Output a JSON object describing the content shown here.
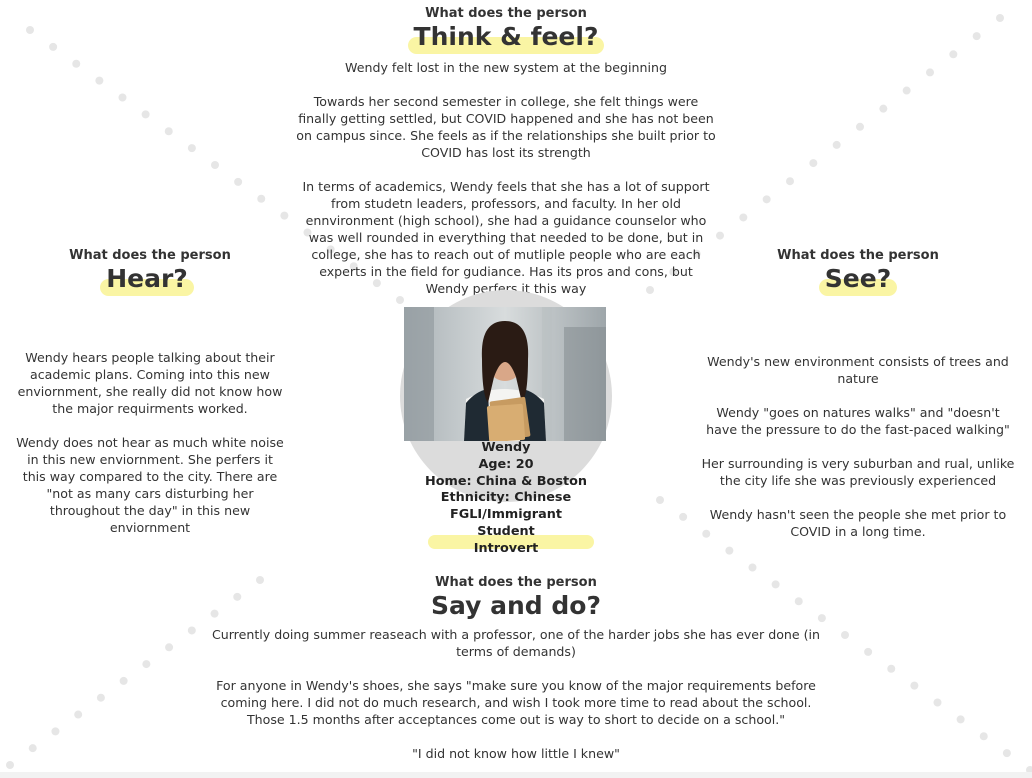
{
  "think": {
    "subtitle": "What does the person",
    "heading": "Think & feel?",
    "paragraphs": [
      "Wendy felt lost in the new system at the beginning",
      "Towards her second semester in college, she felt things were finally getting settled, but COVID happened and she has not been on campus since. She feels as if the relationships she built prior to COVID has lost its strength",
      "In terms of academics, Wendy feels that she has a lot of support from studetn leaders, professors, and faculty. In her old ennvironment (high school), she had a guidance counselor who was well rounded in everything that needed to be done, but in college, she has to reach out of mutliple people who are each experts in the field for gudiance. Has its pros and cons, but Wendy perfers it this way"
    ]
  },
  "hear": {
    "subtitle": "What does the person",
    "heading": "Hear?",
    "paragraphs": [
      "Wendy hears people talking about their academic plans. Coming into this new enviornment, she really did not know how the major requirments worked.",
      "Wendy does not hear as much white noise in this new enviornment. She perfers it this way compared to the city. There are \"not as many cars disturbing her throughout the day\" in this new enviornment"
    ]
  },
  "see": {
    "subtitle": "What does the person",
    "heading": "See?",
    "paragraphs": [
      "Wendy's new environment consists of trees and nature",
      "Wendy \"goes on natures walks\" and \"doesn't have the pressure to do the fast-paced walking\"",
      "Her surrounding is very suburban and rual, unlike the city life she was previously experienced",
      "Wendy hasn't seen the people she met prior to COVID in a long time."
    ]
  },
  "say": {
    "subtitle": "What does the person",
    "heading": "Say and do?",
    "paragraphs": [
      "Currently doing summer reaseach with a professor, one of the harder jobs she has ever done (in terms of demands)",
      "For anyone in Wendy's shoes, she says \"make sure you know of the major requirements before coming here. I did not do much research, and wish I took more time to read about the school. Those 1.5 months after acceptances come out is way to short to decide on a school.\"",
      "\"I did not know how little I knew\""
    ]
  },
  "profile": {
    "name": "Wendy",
    "age": "Age: 20",
    "home": "Home: China & Boston",
    "ethnicity": "Ethnicity: Chinese",
    "status": "FGLI/Immigrant",
    "role": "Student",
    "personality": "Introvert"
  },
  "colors": {
    "highlight": "#faf5a4",
    "dots": "#e6e6e6",
    "circle": "#dcdcdc"
  }
}
